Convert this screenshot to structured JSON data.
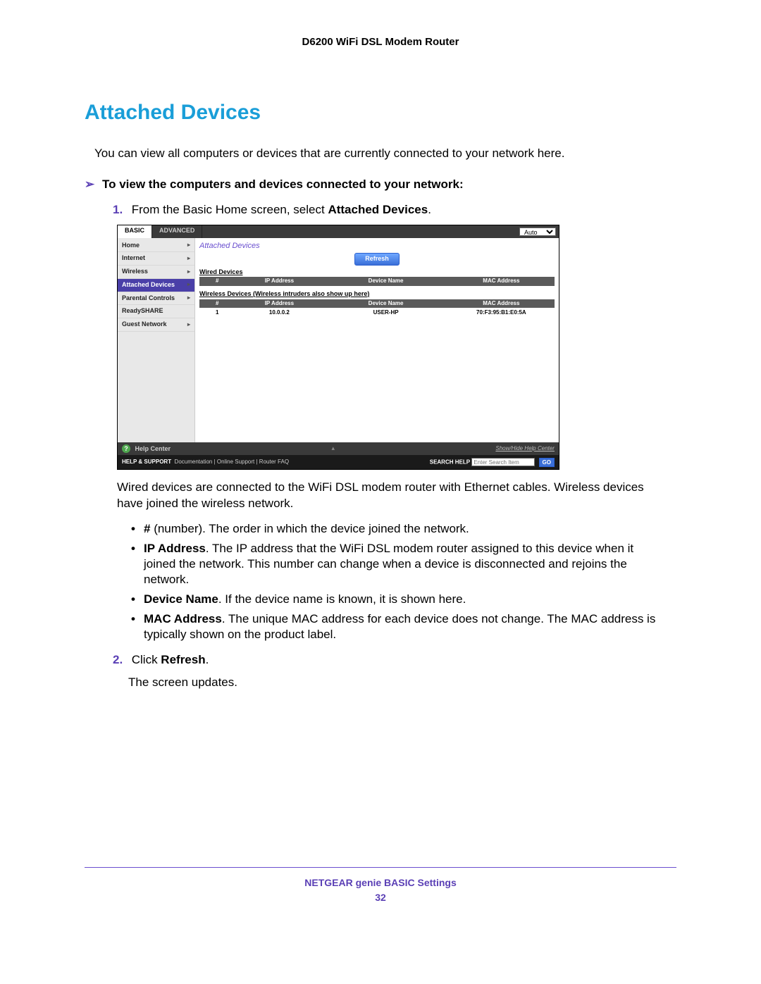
{
  "header": {
    "product": "D6200 WiFi DSL Modem Router"
  },
  "section": {
    "title": "Attached Devices",
    "intro": "You can view all computers or devices that are currently connected to your network here.",
    "task_label": "To view the computers and devices connected to your network:",
    "step1_prefix": "From the Basic Home screen, select ",
    "step1_bold": "Attached Devices",
    "step1_suffix": ".",
    "post_img": "Wired devices are connected to the WiFi DSL modem router with Ethernet cables. Wireless devices have joined the wireless network.",
    "bullets": {
      "num": {
        "b": "#",
        "t": " (number). The order in which the device joined the network."
      },
      "ip": {
        "b": "IP Address",
        "t": ". The IP address that the WiFi DSL modem router assigned to this device when it joined the network. This number can change when a device is disconnected and rejoins the network."
      },
      "name": {
        "b": "Device Name",
        "t": ". If the device name is known, it is shown here."
      },
      "mac": {
        "b": "MAC Address",
        "t": ". The unique MAC address for each device does not change. The MAC address is typically shown on the product label."
      }
    },
    "step2_prefix": "Click ",
    "step2_bold": "Refresh",
    "step2_suffix": ".",
    "step2_result": "The screen updates."
  },
  "ui": {
    "tabs": {
      "basic": "BASIC",
      "advanced": "ADVANCED",
      "lang": "Auto"
    },
    "side": {
      "home": "Home",
      "internet": "Internet",
      "wireless": "Wireless",
      "attached": "Attached Devices",
      "parental": "Parental Controls",
      "ready": "ReadySHARE",
      "guest": "Guest Network"
    },
    "main": {
      "title": "Attached Devices",
      "refresh": "Refresh",
      "wired_label": "Wired Devices",
      "wireless_label": "Wireless Devices (Wireless intruders also show up here)",
      "cols": {
        "num": "#",
        "ip": "IP Address",
        "name": "Device Name",
        "mac": "MAC Address"
      },
      "row": {
        "num": "1",
        "ip": "10.0.0.2",
        "name": "USER-HP",
        "mac": "70:F3:95:B1:E0:5A"
      }
    },
    "helpbar": {
      "label": "Help Center",
      "show": "Show/Hide Help Center"
    },
    "footer": {
      "hs": "HELP & SUPPORT",
      "doc": "Documentation",
      "online": "Online Support",
      "faq": "Router FAQ",
      "search_label": "SEARCH HELP",
      "search_ph": "Enter Search Item",
      "go": "GO"
    }
  },
  "footer": {
    "title": "NETGEAR genie BASIC Settings",
    "page": "32"
  }
}
